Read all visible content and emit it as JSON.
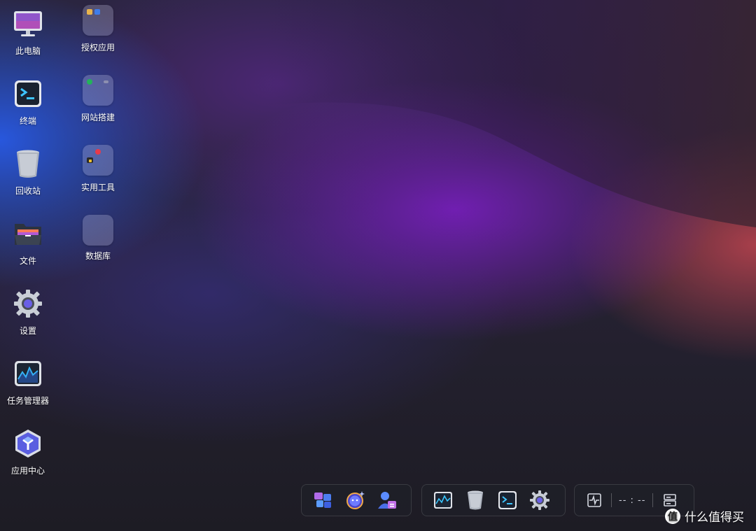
{
  "desktop_left": [
    {
      "label": "此电脑",
      "icon": "monitor-icon"
    },
    {
      "label": "终端",
      "icon": "terminal-icon"
    },
    {
      "label": "回收站",
      "icon": "trash-icon"
    },
    {
      "label": "文件",
      "icon": "folder-icon"
    },
    {
      "label": "设置",
      "icon": "gear-icon"
    },
    {
      "label": "任务管理器",
      "icon": "activity-monitor-icon"
    },
    {
      "label": "应用中心",
      "icon": "app-center-icon"
    }
  ],
  "desktop_right": [
    {
      "label": "授权应用",
      "icon": "folder-group-icon"
    },
    {
      "label": "网站搭建",
      "icon": "folder-group-icon"
    },
    {
      "label": "实用工具",
      "icon": "folder-group-icon"
    },
    {
      "label": "数据库",
      "icon": "folder-group-icon"
    }
  ],
  "dock": {
    "group1": [
      "launcher-icon",
      "assistant-icon",
      "user-icon"
    ],
    "group2": [
      "activity-monitor-icon",
      "trash-icon",
      "terminal-icon",
      "gear-icon"
    ],
    "status": {
      "clock": "-- : --"
    }
  },
  "watermark": {
    "badge": "值",
    "text": "什么值得买"
  },
  "colors": {
    "accent": "#3b82f6",
    "panel": "#1e2028"
  }
}
